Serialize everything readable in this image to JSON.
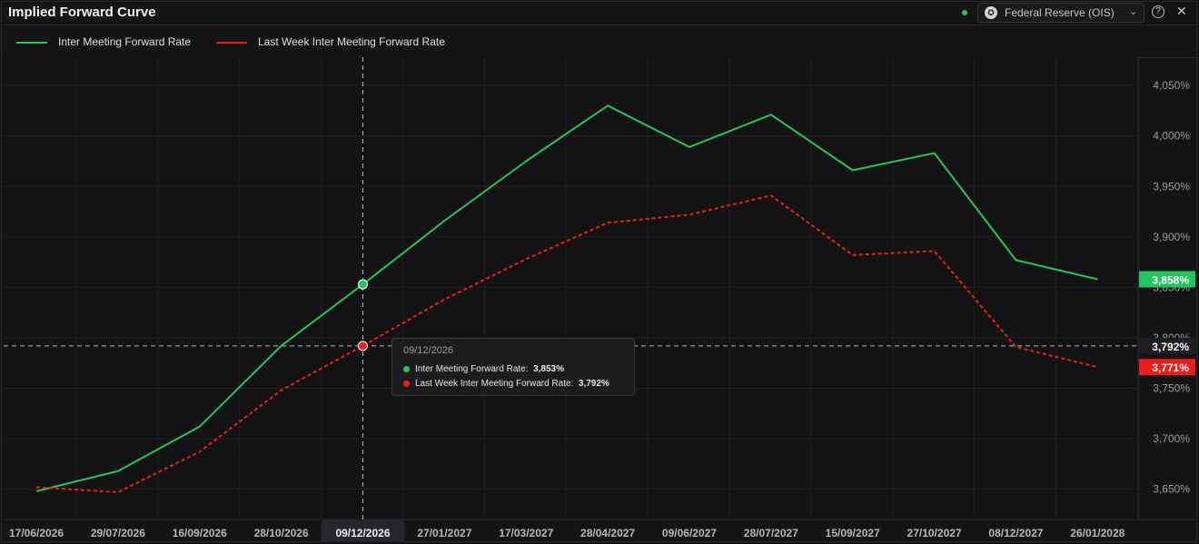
{
  "header": {
    "title": "Implied Forward Curve",
    "source": "Federal Reserve (OIS)",
    "status_color": "#22c55e"
  },
  "chart_data": {
    "type": "line",
    "x": [
      "17/06/2026",
      "29/07/2026",
      "16/09/2026",
      "28/10/2026",
      "09/12/2026",
      "27/01/2027",
      "17/03/2027",
      "28/04/2027",
      "09/06/2027",
      "28/07/2027",
      "15/09/2027",
      "27/10/2027",
      "08/12/2027",
      "26/01/2028"
    ],
    "series": [
      {
        "name": "Inter Meeting Forward Rate",
        "color": "#22c55e",
        "style": "solid",
        "values": [
          3.648,
          3.668,
          3.712,
          3.792,
          3.853,
          3.916,
          3.975,
          4.03,
          3.989,
          4.021,
          3.966,
          3.983,
          3.877,
          3.858
        ]
      },
      {
        "name": "Last Week Inter Meeting Forward Rate",
        "color": "#ef1c1c",
        "style": "dashed",
        "values": [
          3.652,
          3.647,
          3.687,
          3.748,
          3.792,
          3.838,
          3.878,
          3.914,
          3.922,
          3.941,
          3.882,
          3.886,
          3.791,
          3.771
        ]
      }
    ],
    "y_ticks": [
      "4,050%",
      "4,000%",
      "3,950%",
      "3,900%",
      "3,850%",
      "3,800%",
      "3,750%",
      "3,700%",
      "3,650%"
    ],
    "ylim": [
      3.62,
      4.078
    ],
    "grid": true,
    "highlight_x_label": "09/12/2026",
    "crosshair_label": "3,792%",
    "last_value_labels": [
      "3,858%",
      "3,771%"
    ]
  },
  "tooltip": {
    "date": "09/12/2026",
    "rows": [
      {
        "label": "Inter Meeting Forward Rate:",
        "value": "3,853%"
      },
      {
        "label": "Last Week Inter Meeting Forward Rate:",
        "value": "3,792%"
      }
    ]
  }
}
